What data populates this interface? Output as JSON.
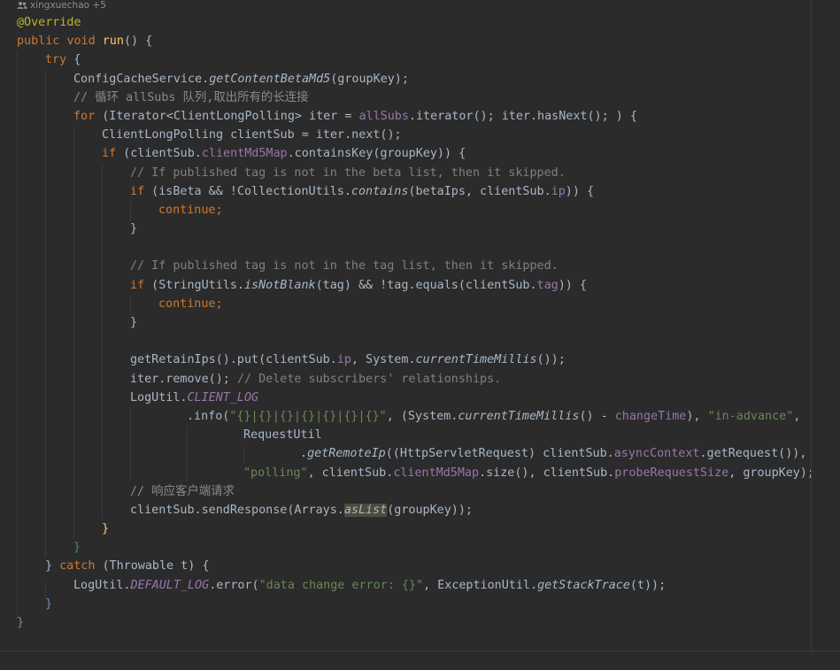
{
  "author_hint": {
    "icon": "users-icon",
    "text": "xingxuechao +5"
  },
  "colors": {
    "background": "#2b2b2b",
    "default_text": "#a9b7c6",
    "keyword": "#cc7832",
    "annotation": "#bbb529",
    "method_declaration": "#ffc66d",
    "field": "#9876aa",
    "string": "#6a8759",
    "comment": "#808080"
  },
  "code": {
    "l01": "@Override",
    "l02_public": "public",
    "l02_void": "void",
    "l02_name": "run",
    "l02_rest": "() {",
    "l03_try": "try",
    "l03_brace": " {",
    "l04_a": "ConfigCacheService.",
    "l04_method": "getContentBetaMd5",
    "l04_b": "(groupKey);",
    "l05_comment": "// 循环 allSubs 队列,取出所有的长连接",
    "l06_for": "for",
    "l06_a": " (Iterator<ClientLongPolling> iter = ",
    "l06_field": "allSubs",
    "l06_b": ".iterator(); iter.hasNext(); ) {",
    "l07": "ClientLongPolling clientSub = iter.next();",
    "l08_if": "if",
    "l08_a": " (clientSub.",
    "l08_field": "clientMd5Map",
    "l08_b": ".containsKey(groupKey)) {",
    "l09_comment": "// If published tag is not in the beta list, then it skipped.",
    "l10_if": "if",
    "l10_a": " (isBeta && !CollectionUtils.",
    "l10_method": "contains",
    "l10_b": "(betaIps, clientSub.",
    "l10_field": "ip",
    "l10_c": ")) {",
    "l11_continue": "continue;",
    "l12_brace": "}",
    "l14_comment": "// If published tag is not in the tag list, then it skipped.",
    "l15_if": "if",
    "l15_a": " (StringUtils.",
    "l15_method": "isNotBlank",
    "l15_b": "(tag) && !tag.equals(clientSub.",
    "l15_field": "tag",
    "l15_c": ")) {",
    "l16_continue": "continue;",
    "l17_brace": "}",
    "l19_a": "getRetainIps().put(clientSub.",
    "l19_field": "ip",
    "l19_b": ", System.",
    "l19_method": "currentTimeMillis",
    "l19_c": "());",
    "l20_a": "iter.remove(); ",
    "l20_comment": "// Delete subscribers' relationships.",
    "l21_a": "LogUtil.",
    "l21_field": "CLIENT_LOG",
    "l22_a": ".info(",
    "l22_str1": "\"{}|{}|{}|{}|{}|{}|{}\"",
    "l22_b": ", (System.",
    "l22_method": "currentTimeMillis",
    "l22_c": "() - ",
    "l22_field": "changeTime",
    "l22_d": "), ",
    "l22_str2": "\"in-advance\"",
    "l22_e": ",",
    "l23": "RequestUtil",
    "l24_a": ".",
    "l24_method": "getRemoteIp",
    "l24_b": "((HttpServletRequest) clientSub.",
    "l24_field": "asyncContext",
    "l24_c": ".getRequest()),",
    "l25_str": "\"polling\"",
    "l25_a": ", clientSub.",
    "l25_field1": "clientMd5Map",
    "l25_b": ".size(), clientSub.",
    "l25_field2": "probeRequestSize",
    "l25_c": ", groupKey);",
    "l26_comment": "// 响应客户端请求",
    "l27_a": "clientSub.sendResponse(Arrays.",
    "l27_method": "asList",
    "l27_b": "(groupKey));",
    "l28_brace": "}",
    "l29_brace": "}",
    "l30_a": "} ",
    "l30_catch": "catch",
    "l30_b": " (Throwable t) {",
    "l31_a": "LogUtil.",
    "l31_field": "DEFAULT_LOG",
    "l31_b": ".error(",
    "l31_str": "\"data change error: {}\"",
    "l31_c": ", ExceptionUtil.",
    "l31_method": "getStackTrace",
    "l31_d": "(t));",
    "l32_brace": "}",
    "l33_brace": "}"
  }
}
